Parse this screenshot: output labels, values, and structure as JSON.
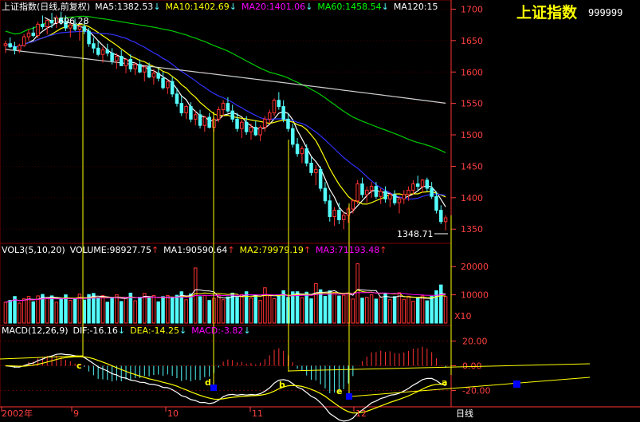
{
  "colors": {
    "background": "#000000",
    "up": "#ff3232",
    "down": "#54fcfc",
    "ma5": "#ffffff",
    "ma10": "#ffff00",
    "ma20": "#ff00ff",
    "ma60": "#00ff00",
    "ma120": "#ffffff",
    "ma20_main_line": "#3232ff",
    "ma60_main_line": "#00cc00",
    "ma120_main_line": "#d0d0d0",
    "grid": "#800000",
    "axis_text": "#ff4040",
    "annotation": "#ffff00",
    "marker": "#0000ff"
  },
  "title": {
    "name": "上证指数",
    "code": "999999"
  },
  "price_panel": {
    "header": [
      {
        "text": "上证指数(日线,前复权)",
        "color": "#ffffff"
      },
      {
        "text": "MA5:1382.53",
        "color": "#ffffff",
        "arrow": "↓"
      },
      {
        "text": "MA10:1402.69",
        "color": "#ffff00",
        "arrow": "↓"
      },
      {
        "text": "MA20:1401.06",
        "color": "#ff00ff",
        "arrow": "↓"
      },
      {
        "text": "MA60:1458.54",
        "color": "#00ff00",
        "arrow": "↓"
      },
      {
        "text": "MA120:15",
        "color": "#ffffff",
        "arrow": ""
      }
    ],
    "yticks": [
      "1700",
      "1650",
      "1600",
      "1550",
      "1500",
      "1450",
      "1400",
      "1350"
    ],
    "high_label": "1696.28",
    "low_label": "1348.71"
  },
  "volume_panel": {
    "header": [
      {
        "text": "VOL3(5,10,20)",
        "color": "#ffffff"
      },
      {
        "text": "VOLUME:98927.75",
        "color": "#ffffff",
        "arrow": "↑"
      },
      {
        "text": "MA1:90590.64",
        "color": "#ffffff",
        "arrow": "↑"
      },
      {
        "text": "MA2:79979.19",
        "color": "#ffff00",
        "arrow": "↑"
      },
      {
        "text": "MA3:71193.48",
        "color": "#ff00ff",
        "arrow": "↑"
      }
    ],
    "yticks": [
      "20000",
      "10000"
    ],
    "unit": "X10"
  },
  "macd_panel": {
    "header": [
      {
        "text": "MACD(12,26,9)",
        "color": "#ffffff"
      },
      {
        "text": "DIF:-16.16",
        "color": "#ffffff",
        "arrow": "↓"
      },
      {
        "text": "DEA:-14.25",
        "color": "#ffff00",
        "arrow": "↓"
      },
      {
        "text": "MACD:-3.82",
        "color": "#ff00ff",
        "arrow": "↓"
      }
    ],
    "yticks": [
      "20.00",
      "0.00",
      "-20.00"
    ],
    "annotations": [
      "c",
      "d",
      "b",
      "e",
      "a"
    ]
  },
  "x_axis": {
    "labels": [
      "2002年",
      "9",
      "10",
      "11",
      "12"
    ],
    "period_button": "日线"
  },
  "chart_data": {
    "type": "candlestick",
    "title": "上证指数",
    "price_range": [
      1330,
      1712
    ],
    "candles": [
      [
        1642,
        1650,
        1630,
        1645
      ],
      [
        1645,
        1655,
        1638,
        1640
      ],
      [
        1640,
        1648,
        1628,
        1635
      ],
      [
        1635,
        1645,
        1630,
        1642
      ],
      [
        1642,
        1660,
        1640,
        1656
      ],
      [
        1656,
        1668,
        1650,
        1662
      ],
      [
        1662,
        1672,
        1655,
        1658
      ],
      [
        1658,
        1680,
        1654,
        1676
      ],
      [
        1676,
        1690,
        1668,
        1672
      ],
      [
        1672,
        1685,
        1660,
        1682
      ],
      [
        1682,
        1694,
        1670,
        1678
      ],
      [
        1678,
        1690,
        1670,
        1686
      ],
      [
        1686,
        1696,
        1675,
        1680
      ],
      [
        1680,
        1690,
        1665,
        1670
      ],
      [
        1670,
        1678,
        1655,
        1675
      ],
      [
        1675,
        1685,
        1665,
        1668
      ],
      [
        1668,
        1675,
        1650,
        1672
      ],
      [
        1672,
        1682,
        1660,
        1665
      ],
      [
        1665,
        1670,
        1640,
        1645
      ],
      [
        1645,
        1655,
        1630,
        1638
      ],
      [
        1638,
        1650,
        1625,
        1628
      ],
      [
        1628,
        1640,
        1615,
        1635
      ],
      [
        1635,
        1645,
        1625,
        1630
      ],
      [
        1630,
        1638,
        1612,
        1618
      ],
      [
        1618,
        1630,
        1605,
        1625
      ],
      [
        1625,
        1635,
        1615,
        1610
      ],
      [
        1610,
        1622,
        1598,
        1620
      ],
      [
        1620,
        1628,
        1600,
        1605
      ],
      [
        1605,
        1615,
        1595,
        1612
      ],
      [
        1612,
        1620,
        1598,
        1600
      ],
      [
        1600,
        1610,
        1585,
        1608
      ],
      [
        1608,
        1615,
        1590,
        1592
      ],
      [
        1592,
        1605,
        1580,
        1598
      ],
      [
        1598,
        1606,
        1585,
        1590
      ],
      [
        1590,
        1600,
        1572,
        1575
      ],
      [
        1575,
        1588,
        1565,
        1585
      ],
      [
        1585,
        1592,
        1560,
        1565
      ],
      [
        1565,
        1575,
        1545,
        1550
      ],
      [
        1550,
        1562,
        1530,
        1535
      ],
      [
        1535,
        1548,
        1525,
        1545
      ],
      [
        1545,
        1552,
        1520,
        1525
      ],
      [
        1525,
        1538,
        1515,
        1532
      ],
      [
        1532,
        1540,
        1510,
        1515
      ],
      [
        1515,
        1530,
        1505,
        1528
      ],
      [
        1528,
        1535,
        1510,
        1512
      ],
      [
        1512,
        1528,
        1505,
        1525
      ],
      [
        1525,
        1545,
        1520,
        1540
      ],
      [
        1540,
        1555,
        1530,
        1550
      ],
      [
        1550,
        1560,
        1535,
        1538
      ],
      [
        1538,
        1548,
        1520,
        1525
      ],
      [
        1525,
        1535,
        1505,
        1510
      ],
      [
        1510,
        1525,
        1495,
        1520
      ],
      [
        1520,
        1530,
        1500,
        1505
      ],
      [
        1505,
        1518,
        1492,
        1512
      ],
      [
        1512,
        1522,
        1498,
        1500
      ],
      [
        1500,
        1515,
        1490,
        1512
      ],
      [
        1512,
        1530,
        1505,
        1525
      ],
      [
        1525,
        1540,
        1518,
        1535
      ],
      [
        1535,
        1558,
        1530,
        1555
      ],
      [
        1555,
        1568,
        1540,
        1545
      ],
      [
        1545,
        1555,
        1520,
        1525
      ],
      [
        1525,
        1535,
        1505,
        1510
      ],
      [
        1510,
        1518,
        1480,
        1485
      ],
      [
        1485,
        1495,
        1465,
        1470
      ],
      [
        1470,
        1482,
        1455,
        1478
      ],
      [
        1478,
        1485,
        1450,
        1455
      ],
      [
        1455,
        1465,
        1435,
        1440
      ],
      [
        1440,
        1452,
        1420,
        1445
      ],
      [
        1445,
        1450,
        1410,
        1415
      ],
      [
        1415,
        1425,
        1390,
        1395
      ],
      [
        1395,
        1405,
        1362,
        1370
      ],
      [
        1370,
        1385,
        1355,
        1380
      ],
      [
        1380,
        1392,
        1358,
        1365
      ],
      [
        1365,
        1378,
        1350,
        1372
      ],
      [
        1372,
        1385,
        1360,
        1382
      ],
      [
        1382,
        1398,
        1375,
        1395
      ],
      [
        1395,
        1428,
        1390,
        1422
      ],
      [
        1422,
        1432,
        1400,
        1405
      ],
      [
        1405,
        1418,
        1392,
        1412
      ],
      [
        1412,
        1425,
        1400,
        1418
      ],
      [
        1418,
        1425,
        1398,
        1402
      ],
      [
        1402,
        1415,
        1390,
        1410
      ],
      [
        1410,
        1418,
        1392,
        1398
      ],
      [
        1398,
        1408,
        1385,
        1405
      ],
      [
        1405,
        1412,
        1388,
        1392
      ],
      [
        1392,
        1402,
        1375,
        1398
      ],
      [
        1398,
        1412,
        1390,
        1405
      ],
      [
        1405,
        1418,
        1395,
        1412
      ],
      [
        1412,
        1428,
        1405,
        1422
      ],
      [
        1422,
        1435,
        1412,
        1418
      ],
      [
        1418,
        1430,
        1408,
        1428
      ],
      [
        1428,
        1432,
        1410,
        1415
      ],
      [
        1415,
        1425,
        1398,
        1402
      ],
      [
        1402,
        1410,
        1375,
        1380
      ],
      [
        1380,
        1388,
        1358,
        1362
      ],
      [
        1362,
        1372,
        1348,
        1368
      ]
    ],
    "ma_lines": [
      {
        "name": "MA5",
        "series_index": 0
      },
      {
        "name": "MA10",
        "series_index": 1
      },
      {
        "name": "MA20",
        "series_index": 2
      },
      {
        "name": "MA60",
        "series_index": 3
      },
      {
        "name": "MA120",
        "series_index": 4
      }
    ]
  }
}
